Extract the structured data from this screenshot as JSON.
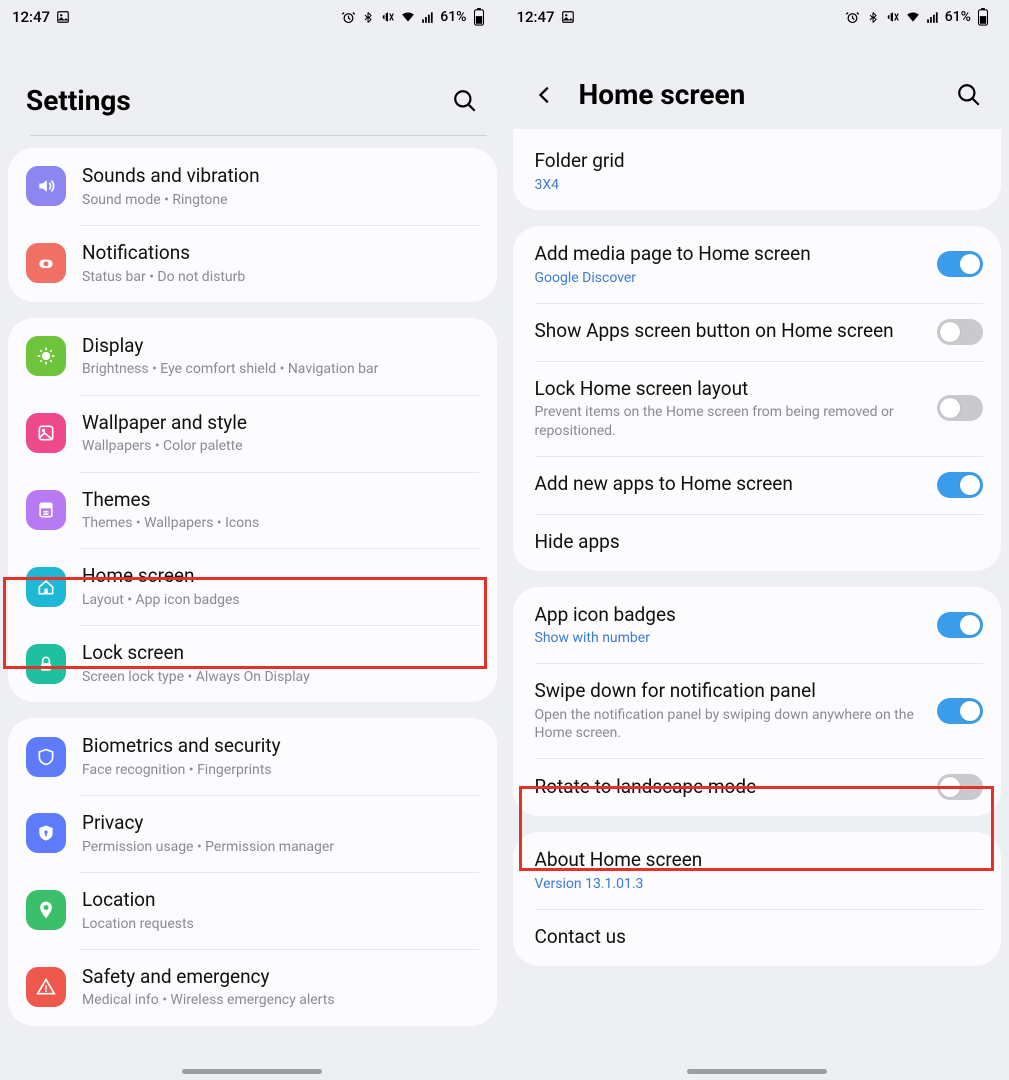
{
  "status": {
    "time": "12:47",
    "battery_text": "61%"
  },
  "left": {
    "title": "Settings",
    "groups": [
      {
        "items": [
          {
            "key": "sounds",
            "title": "Sounds and vibration",
            "sub": "Sound mode  •  Ringtone",
            "iconColor": "#8b86f0",
            "icon": "sound"
          },
          {
            "key": "notifications",
            "title": "Notifications",
            "sub": "Status bar  •  Do not disturb",
            "iconColor": "#f07066",
            "icon": "notif"
          }
        ]
      },
      {
        "items": [
          {
            "key": "display",
            "title": "Display",
            "sub": "Brightness  •  Eye comfort shield  •  Navigation bar",
            "iconColor": "#6ec43a",
            "icon": "display"
          },
          {
            "key": "wallpaper",
            "title": "Wallpaper and style",
            "sub": "Wallpapers  •  Color palette",
            "iconColor": "#ee4a8b",
            "icon": "wallpaper"
          },
          {
            "key": "themes",
            "title": "Themes",
            "sub": "Themes  •  Wallpapers  •  Icons",
            "iconColor": "#b87af2",
            "icon": "themes"
          },
          {
            "key": "home",
            "title": "Home screen",
            "sub": "Layout  •  App icon badges",
            "iconColor": "#1fb7d6",
            "icon": "home"
          },
          {
            "key": "lock",
            "title": "Lock screen",
            "sub": "Screen lock type  •  Always On Display",
            "iconColor": "#1fc0a0",
            "icon": "lock"
          }
        ]
      },
      {
        "items": [
          {
            "key": "biometrics",
            "title": "Biometrics and security",
            "sub": "Face recognition  •  Fingerprints",
            "iconColor": "#5d7bfb",
            "icon": "shield"
          },
          {
            "key": "privacy",
            "title": "Privacy",
            "sub": "Permission usage  •  Permission manager",
            "iconColor": "#5d7bfb",
            "icon": "privacy"
          },
          {
            "key": "location",
            "title": "Location",
            "sub": "Location requests",
            "iconColor": "#3bbf6a",
            "icon": "location"
          },
          {
            "key": "safety",
            "title": "Safety and emergency",
            "sub": "Medical info  •  Wireless emergency alerts",
            "iconColor": "#ef584c",
            "icon": "safety"
          }
        ]
      }
    ]
  },
  "right": {
    "title": "Home screen",
    "sections": [
      {
        "items": [
          {
            "key": "folder-grid",
            "title": "Folder grid",
            "sub": "3X4",
            "subLink": true
          }
        ],
        "trimTop": true
      },
      {
        "items": [
          {
            "key": "media-page",
            "title": "Add media page to Home screen",
            "sub": "Google Discover",
            "subLink": true,
            "toggle": true,
            "on": true
          },
          {
            "key": "apps-button",
            "title": "Show Apps screen button on Home screen",
            "toggle": true,
            "on": false
          },
          {
            "key": "lock-layout",
            "title": "Lock Home screen layout",
            "sub": "Prevent items on the Home screen from being removed or repositioned.",
            "toggle": true,
            "on": false
          },
          {
            "key": "add-new-apps",
            "title": "Add new apps to Home screen",
            "toggle": true,
            "on": true
          },
          {
            "key": "hide-apps",
            "title": "Hide apps"
          }
        ]
      },
      {
        "items": [
          {
            "key": "icon-badges",
            "title": "App icon badges",
            "sub": "Show with number",
            "subLink": true,
            "toggle": true,
            "on": true
          },
          {
            "key": "swipe-down",
            "title": "Swipe down for notification panel",
            "sub": "Open the notification panel by swiping down anywhere on the Home screen.",
            "toggle": true,
            "on": true
          },
          {
            "key": "rotate",
            "title": "Rotate to landscape mode",
            "toggle": true,
            "on": false
          }
        ]
      },
      {
        "items": [
          {
            "key": "about",
            "title": "About Home screen",
            "sub": "Version 13.1.01.3",
            "subLink": true
          },
          {
            "key": "contact",
            "title": "Contact us"
          }
        ]
      }
    ]
  }
}
